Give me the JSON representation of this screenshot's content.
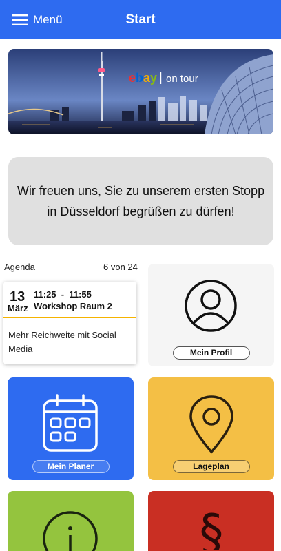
{
  "header": {
    "menu_label": "Menü",
    "title": "Start"
  },
  "banner": {
    "brand": "ebay",
    "brand_suffix": "on tour"
  },
  "welcome": {
    "text": "Wir freuen uns, Sie zu unserem ersten Stopp in Düsseldorf begrüßen zu dürfen!"
  },
  "agenda": {
    "label": "Agenda",
    "count": "6 von 24",
    "item": {
      "day": "13",
      "month": "März",
      "time": "11:25  -  11:55",
      "room": "Workshop Raum 2",
      "description": "Mehr Reichweite mit Social Media"
    }
  },
  "tiles": {
    "profile": {
      "label": "Mein Profil",
      "color": "#f5f5f5",
      "icon": "user-icon"
    },
    "planner": {
      "label": "Mein Planer",
      "color": "#2e6bf0",
      "icon": "calendar-icon"
    },
    "map": {
      "label": "Lageplan",
      "color": "#f4bf45",
      "icon": "location-pin-icon"
    },
    "info": {
      "color": "#94c43e",
      "icon": "info-icon"
    },
    "legal": {
      "color": "#c92f23",
      "icon": "paragraph-icon"
    }
  },
  "colors": {
    "accent": "#2e6bf0",
    "agenda_divider": "#f5b300"
  }
}
